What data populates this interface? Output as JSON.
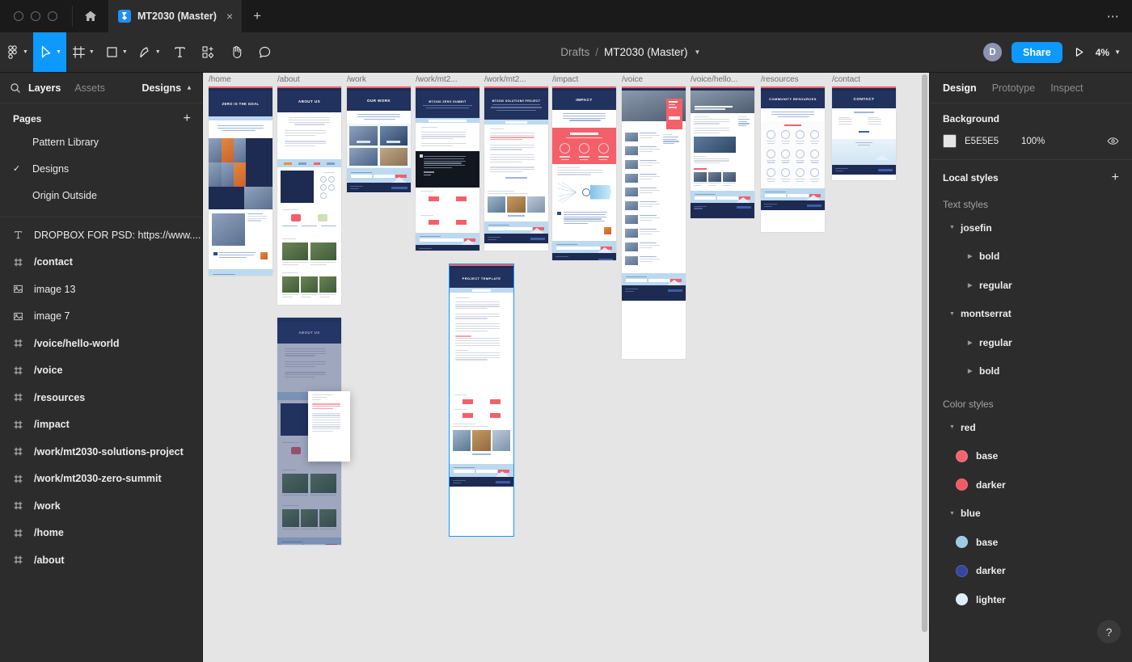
{
  "window": {
    "traffic_lights": [
      "close",
      "minimize",
      "maximize"
    ],
    "home_icon": "home-icon",
    "more_icon": "ellipsis-icon"
  },
  "tab": {
    "favicon": "figma-file-icon",
    "title": "MT2030 (Master)",
    "close_label": "×",
    "new_tab_label": "+"
  },
  "toolbar": {
    "tools": [
      {
        "name": "figma-menu",
        "icon": "figma-logo-icon",
        "has_caret": true,
        "active": false
      },
      {
        "name": "move-tool",
        "icon": "cursor-arrow-icon",
        "has_caret": true,
        "active": true
      },
      {
        "name": "frame-tool",
        "icon": "frame-icon",
        "has_caret": true,
        "active": false
      },
      {
        "name": "shape-tool",
        "icon": "square-icon",
        "has_caret": true,
        "active": false
      },
      {
        "name": "pen-tool",
        "icon": "pen-icon",
        "has_caret": true,
        "active": false
      },
      {
        "name": "text-tool",
        "icon": "text-t-icon",
        "has_caret": false,
        "active": false
      },
      {
        "name": "resources-tool",
        "icon": "components-plus-icon",
        "has_caret": false,
        "active": false
      },
      {
        "name": "hand-tool",
        "icon": "hand-icon",
        "has_caret": false,
        "active": false
      },
      {
        "name": "comment-tool",
        "icon": "comment-bubble-icon",
        "has_caret": false,
        "active": false
      }
    ],
    "breadcrumb_project": "Drafts",
    "breadcrumb_separator": "/",
    "breadcrumb_file": "MT2030 (Master)",
    "avatar_initial": "D",
    "share_label": "Share",
    "present_icon": "play-triangle-icon",
    "zoom_level": "4%"
  },
  "left_panel": {
    "search_icon": "search-icon",
    "tabs": [
      {
        "label": "Layers",
        "active": true
      },
      {
        "label": "Assets",
        "active": false
      }
    ],
    "designs_dropdown": "Designs",
    "pages_title": "Pages",
    "add_page_label": "+",
    "pages": [
      {
        "label": "Pattern Library",
        "selected": false
      },
      {
        "label": "Designs",
        "selected": true
      },
      {
        "label": "Origin Outside",
        "selected": false
      }
    ],
    "layers": [
      {
        "label": "DROPBOX FOR PSD: https://www....",
        "icon": "text-layer-icon",
        "bold": false
      },
      {
        "label": "/contact",
        "icon": "frame-layer-icon",
        "bold": true
      },
      {
        "label": "image 13",
        "icon": "image-layer-icon",
        "bold": false
      },
      {
        "label": "image 7",
        "icon": "image-layer-icon",
        "bold": false
      },
      {
        "label": "/voice/hello-world",
        "icon": "frame-layer-icon",
        "bold": true
      },
      {
        "label": "/voice",
        "icon": "frame-layer-icon",
        "bold": true
      },
      {
        "label": "/resources",
        "icon": "frame-layer-icon",
        "bold": true
      },
      {
        "label": "/impact",
        "icon": "frame-layer-icon",
        "bold": true
      },
      {
        "label": "/work/mt2030-solutions-project",
        "icon": "frame-layer-icon",
        "bold": true
      },
      {
        "label": "/work/mt2030-zero-summit",
        "icon": "frame-layer-icon",
        "bold": true
      },
      {
        "label": "/work",
        "icon": "frame-layer-icon",
        "bold": true
      },
      {
        "label": "/home",
        "icon": "frame-layer-icon",
        "bold": true
      },
      {
        "label": "/about",
        "icon": "frame-layer-icon",
        "bold": true
      }
    ]
  },
  "canvas": {
    "background_color": "#E5E5E5",
    "frames": [
      {
        "label": "/home",
        "hero_title": "ZERO IS THE GOAL"
      },
      {
        "label": "/about",
        "hero_title": "ABOUT US"
      },
      {
        "label": "/work",
        "hero_title": "OUR WORK"
      },
      {
        "label": "/work/mt2...",
        "hero_title": "MT2030 ZERO SUMMIT"
      },
      {
        "label": "/work/mt2...",
        "hero_title": "MT2030 SOLUTIONS PROJECT"
      },
      {
        "label": "/impact",
        "hero_title": "IMPACT"
      },
      {
        "label": "/voice",
        "hero_title": ""
      },
      {
        "label": "/voice/hello...",
        "hero_title": ""
      },
      {
        "label": "/resources",
        "hero_title": "COMMUNITY RESOURCES"
      },
      {
        "label": "/contact",
        "hero_title": "CONTACT"
      }
    ],
    "loose_frames": [
      {
        "hero_title": "ABOUT US",
        "selected": false
      },
      {
        "hero_title": "PROJECT TEMPLATE",
        "selected": true
      }
    ]
  },
  "right_panel": {
    "tabs": [
      {
        "label": "Design",
        "active": true
      },
      {
        "label": "Prototype",
        "active": false
      },
      {
        "label": "Inspect",
        "active": false
      }
    ],
    "background": {
      "title": "Background",
      "hex": "E5E5E5",
      "opacity": "100%",
      "swatch_color": "#E5E5E5",
      "visibility_icon": "eye-icon"
    },
    "local_styles": {
      "title": "Local styles",
      "add_label": "+",
      "text_styles_label": "Text styles",
      "text_styles": [
        {
          "name": "josefin",
          "expanded": true,
          "children": [
            {
              "name": "bold"
            },
            {
              "name": "regular"
            }
          ]
        },
        {
          "name": "montserrat",
          "expanded": true,
          "children": [
            {
              "name": "regular"
            },
            {
              "name": "bold"
            }
          ]
        }
      ],
      "color_styles_label": "Color styles",
      "color_styles": [
        {
          "name": "red",
          "expanded": true,
          "children": [
            {
              "name": "base",
              "color": "#F4646E"
            },
            {
              "name": "darker",
              "color": "#F15964"
            }
          ]
        },
        {
          "name": "blue",
          "expanded": true,
          "children": [
            {
              "name": "base",
              "color": "#9CCBE3"
            },
            {
              "name": "darker",
              "color": "#36479B"
            },
            {
              "name": "lighter",
              "color": "#DEEDF6"
            }
          ]
        }
      ]
    },
    "help_label": "?"
  }
}
